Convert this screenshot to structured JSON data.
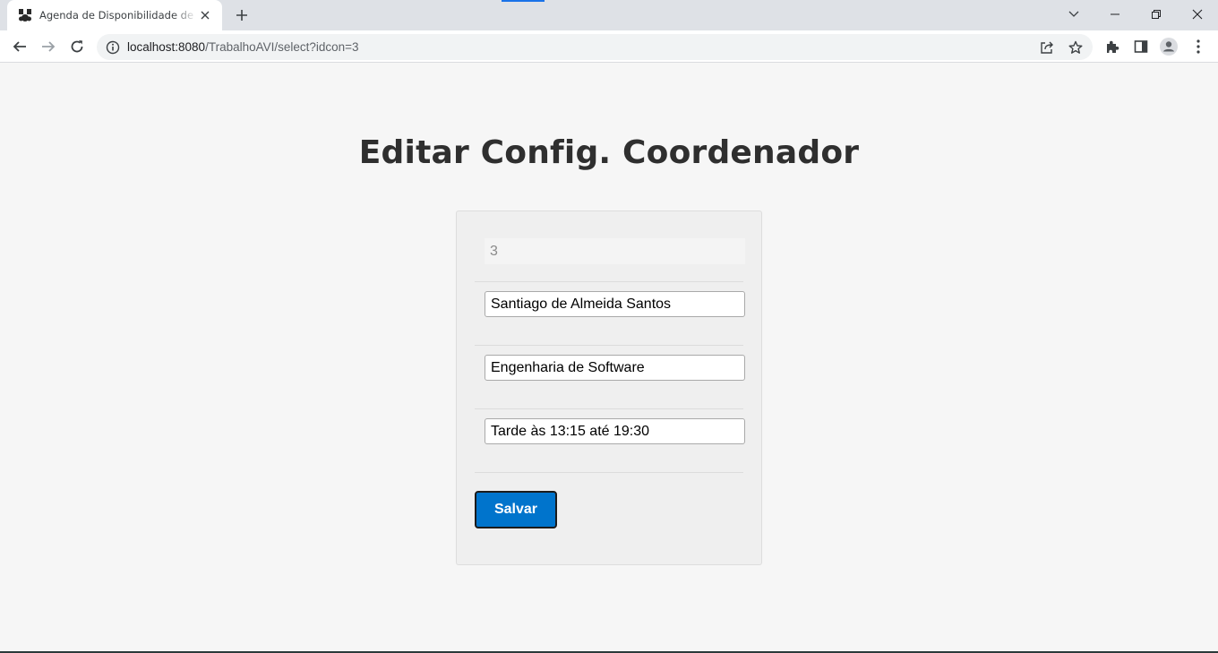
{
  "browser": {
    "tab": {
      "title": "Agenda de Disponibilidade de Coordenadores",
      "favicon": "app-favicon-icon",
      "close_icon": "close-icon"
    },
    "new_tab_icon": "plus-icon",
    "window_controls": [
      "chevron-down-icon",
      "minimize-icon",
      "restore-icon",
      "close-icon"
    ],
    "address": {
      "host": "localhost:8080",
      "path": "/TrabalhoAVI/select?idcon=3"
    }
  },
  "page": {
    "title": "Editar Config. Coordenador",
    "form": {
      "id_value": "3",
      "name_value": "Santiago de Almeida Santos",
      "course_value": "Engenharia de Software",
      "schedule_value": "Tarde às 13:15 até 19:30",
      "submit_label": "Salvar"
    }
  },
  "colors": {
    "accent": "#0074cc",
    "background": "#f6f6f6",
    "card": "#efefef",
    "title": "#2f2f2f"
  }
}
